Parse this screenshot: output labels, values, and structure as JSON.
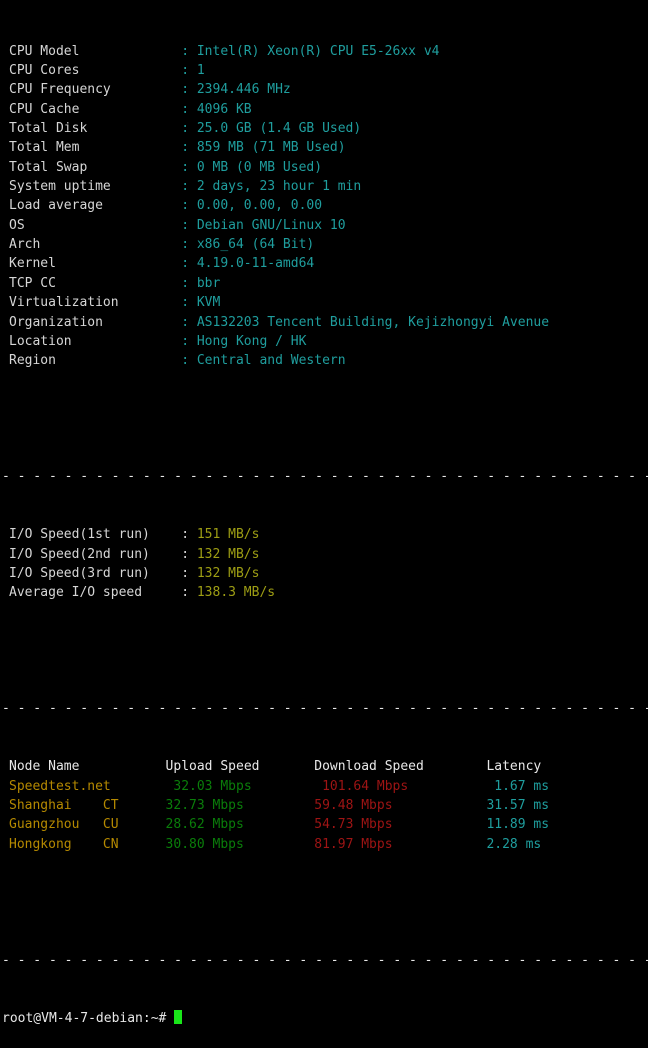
{
  "terminal": {
    "background_color": "#000000",
    "label_color": "#d6d6d6",
    "value_color": "#1f9e9e",
    "io_color": "#9e9e14",
    "node_color": "#b58900",
    "upload_color": "#0a7d0a",
    "download_color": "#9e1414",
    "latency_color": "#1f9e9e",
    "cursor_color": "#19e619",
    "separator": "- - - - - - - - - - - - - - - - - - - - - - - - - - - - - - - - - - - - - - - - - - - - - - - - - - - - - - - - - - - - - - - - - - - - - - -"
  },
  "system_info": [
    {
      "label": "CPU Model",
      "colon": ":",
      "value": "Intel(R) Xeon(R) CPU E5-26xx v4"
    },
    {
      "label": "CPU Cores",
      "colon": ":",
      "value": "1"
    },
    {
      "label": "CPU Frequency",
      "colon": ":",
      "value": "2394.446 MHz"
    },
    {
      "label": "CPU Cache",
      "colon": ":",
      "value": "4096 KB"
    },
    {
      "label": "Total Disk",
      "colon": ":",
      "value": "25.0 GB (1.4 GB Used)"
    },
    {
      "label": "Total Mem",
      "colon": ":",
      "value": "859 MB (71 MB Used)"
    },
    {
      "label": "Total Swap",
      "colon": ":",
      "value": "0 MB (0 MB Used)"
    },
    {
      "label": "System uptime",
      "colon": ":",
      "value": "2 days, 23 hour 1 min"
    },
    {
      "label": "Load average",
      "colon": ":",
      "value": "0.00, 0.00, 0.00"
    },
    {
      "label": "OS",
      "colon": ":",
      "value": "Debian GNU/Linux 10"
    },
    {
      "label": "Arch",
      "colon": ":",
      "value": "x86_64 (64 Bit)"
    },
    {
      "label": "Kernel",
      "colon": ":",
      "value": "4.19.0-11-amd64"
    },
    {
      "label": "TCP CC",
      "colon": ":",
      "value": "bbr"
    },
    {
      "label": "Virtualization",
      "colon": ":",
      "value": "KVM"
    },
    {
      "label": "Organization",
      "colon": ":",
      "value": "AS132203 Tencent Building, Kejizhongyi Avenue"
    },
    {
      "label": "Location",
      "colon": ":",
      "value": "Hong Kong / HK"
    },
    {
      "label": "Region",
      "colon": ":",
      "value": "Central and Western"
    }
  ],
  "io_speed": [
    {
      "label": "I/O Speed(1st run)",
      "colon": ":",
      "value": "151 MB/s"
    },
    {
      "label": "I/O Speed(2nd run)",
      "colon": ":",
      "value": "132 MB/s"
    },
    {
      "label": "I/O Speed(3rd run)",
      "colon": ":",
      "value": "132 MB/s"
    },
    {
      "label": "Average I/O speed",
      "colon": ":",
      "value": "138.3 MB/s"
    }
  ],
  "speedtest": {
    "headers": {
      "node": "Node Name",
      "upload": "Upload Speed",
      "download": "Download Speed",
      "latency": "Latency"
    },
    "rows": [
      {
        "node": "Speedtest.net",
        "isp": "",
        "upload": "32.03 Mbps",
        "download": "101.64 Mbps",
        "latency": "1.67 ms"
      },
      {
        "node": "Shanghai",
        "isp": "CT",
        "upload": "32.73 Mbps",
        "download": "59.48 Mbps",
        "latency": "31.57 ms"
      },
      {
        "node": "Guangzhou",
        "isp": "CU",
        "upload": "28.62 Mbps",
        "download": "54.73 Mbps",
        "latency": "11.89 ms"
      },
      {
        "node": "Hongkong",
        "isp": "CN",
        "upload": "30.80 Mbps",
        "download": "81.97 Mbps",
        "latency": "2.28 ms"
      }
    ]
  },
  "prompt": {
    "text": "root@VM-4-7-debian:~#",
    "cursor": ""
  }
}
